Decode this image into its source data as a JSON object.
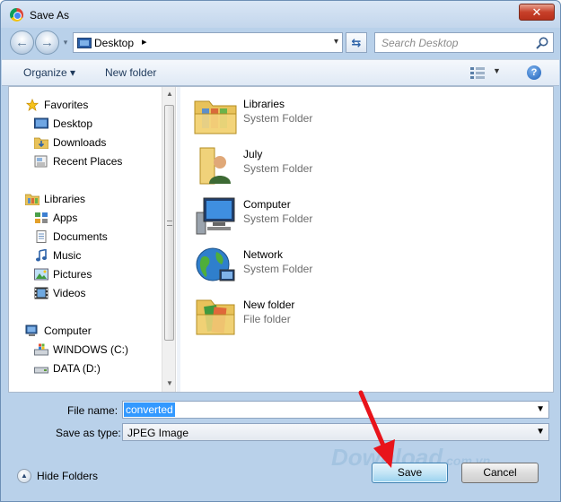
{
  "window": {
    "title": "Save As",
    "close_label": "✕"
  },
  "address": {
    "location": "Desktop",
    "arrow": "▸",
    "drop": "▾"
  },
  "search": {
    "placeholder": "Search Desktop"
  },
  "toolbar": {
    "organize_label": "Organize ▾",
    "new_folder_label": "New folder",
    "help": "?"
  },
  "nav": {
    "favorites": {
      "label": "Favorites",
      "items": [
        "Desktop",
        "Downloads",
        "Recent Places"
      ]
    },
    "libraries": {
      "label": "Libraries",
      "items": [
        "Apps",
        "Documents",
        "Music",
        "Pictures",
        "Videos"
      ]
    },
    "computer": {
      "label": "Computer",
      "items": [
        "WINDOWS (C:)",
        "DATA (D:)"
      ]
    }
  },
  "files": [
    {
      "name": "Libraries",
      "type": "System Folder",
      "icon": "libraries-icon"
    },
    {
      "name": "July",
      "type": "System Folder",
      "icon": "user-folder-icon"
    },
    {
      "name": "Computer",
      "type": "System Folder",
      "icon": "computer-icon"
    },
    {
      "name": "Network",
      "type": "System Folder",
      "icon": "network-icon"
    },
    {
      "name": "New folder",
      "type": "File folder",
      "icon": "folder-icon"
    }
  ],
  "form": {
    "file_name_label": "File name:",
    "file_name_value": "converted",
    "save_type_label": "Save as type:",
    "save_type_value": "JPEG Image"
  },
  "footer": {
    "hide_folders_label": "Hide Folders",
    "save_label": "Save",
    "cancel_label": "Cancel"
  },
  "watermark": {
    "text": "Download",
    "suffix": ".com.vn"
  },
  "colors": {
    "accent": "#3399ff",
    "arrow": "#e8141b",
    "window_frame": "#b9d1ea"
  }
}
